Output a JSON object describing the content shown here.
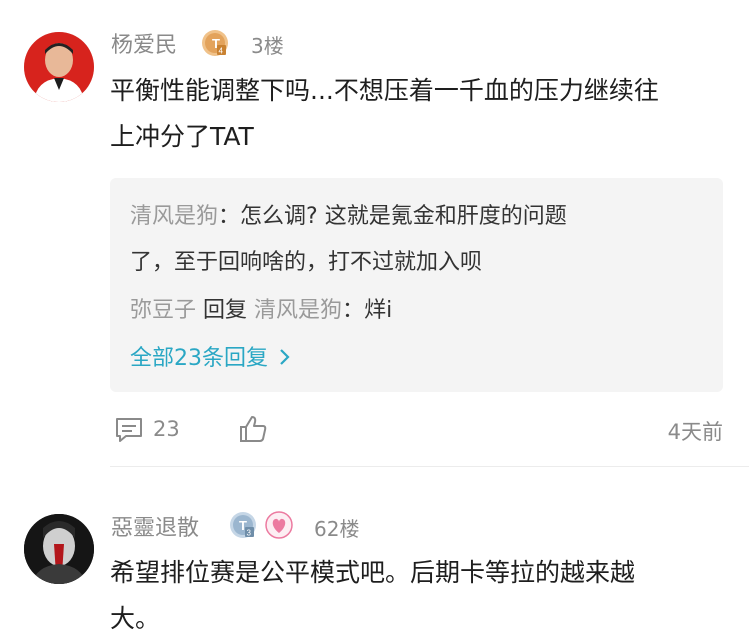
{
  "comments": [
    {
      "username": "杨爱民",
      "level_badge": "T4",
      "floor": "3楼",
      "text_lines": [
        "平衡性能调整下吗...不想压着一千血的压力继续往",
        "上冲分了TAT"
      ],
      "replies": [
        {
          "name": "清风是狗",
          "separator": "：",
          "text_line1": "怎么调? 这就是氪金和肝度的问题",
          "text_line2": "了，至于回响啥的，打不过就加入呗"
        },
        {
          "name": "弥豆子",
          "reply_word": "回复",
          "target": "清风是狗",
          "separator": "：",
          "text": "烊i"
        }
      ],
      "more_replies": "全部23条回复",
      "comment_count": "23",
      "time": "4天前"
    },
    {
      "username": "惡靈退散",
      "level_badge": "T3",
      "floor": "62楼",
      "text_lines": [
        "希望排位赛是公平模式吧。后期卡等拉的越来越",
        "大。"
      ]
    }
  ],
  "colors": {
    "accent_link": "#2aa7c4",
    "muted_text": "#8a8a8a",
    "reply_bg": "#f4f4f4",
    "badge_gold": "#e3a35c",
    "badge_silver": "#9bb6cf",
    "badge_pink": "#ec7aa0"
  },
  "icons": {
    "comment": "comment-bubble-icon",
    "like": "thumbs-up-icon",
    "more": "chevron-right-icon"
  }
}
